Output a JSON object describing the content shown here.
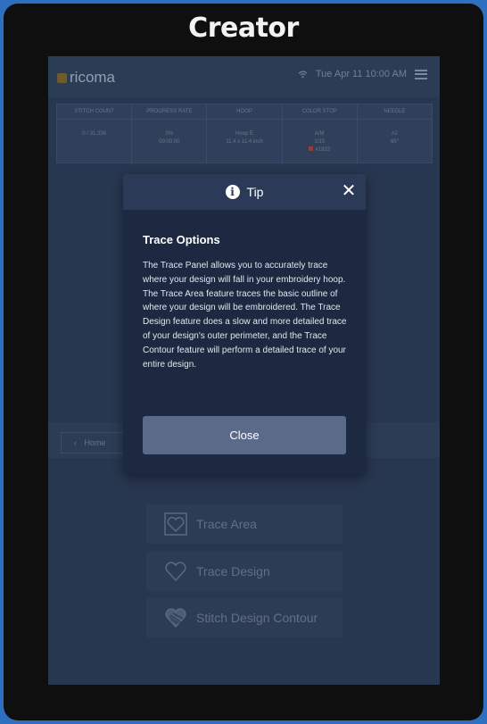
{
  "brand": "Creator",
  "app": {
    "logo_text": "ricoma",
    "datetime": "Tue Apr 11 10:00 AM"
  },
  "stats": {
    "headers": [
      "STITCH COUNT",
      "PROGRESS RATE",
      "HOOP",
      "COLOR STOP",
      "NEEDLE"
    ],
    "values": [
      [
        "0 / 31,336",
        ""
      ],
      [
        "0%",
        "00:00:00"
      ],
      [
        "Hoop E",
        "11.4 x 11.4 inch"
      ],
      [
        "A/M",
        "1/15",
        "#1923"
      ],
      [
        "#2",
        "65°"
      ]
    ]
  },
  "nav": {
    "home_label": "Home"
  },
  "trace": {
    "area_label": "Trace Area",
    "design_label": "Trace Design",
    "contour_label": "Stitch Design Contour"
  },
  "dialog": {
    "title": "Tip",
    "heading": "Trace Options",
    "body": "The Trace Panel allows you to accurately trace where your design will fall in your embroidery hoop. The Trace Area feature traces the basic outline of where your design will be embroidered. The Trace Design feature does a slow and more detailed trace of your design's outer perimeter, and the Trace Contour feature will perform a detailed trace of your entire design.",
    "close_label": "Close"
  },
  "colors": {
    "outer_border": "#2f6fc0",
    "device": "#0f0f0f",
    "screen": "#2f3e59",
    "dialog": "#1d2940",
    "dialog_header": "#2b3a56",
    "close_button": "#5a6b8a"
  }
}
